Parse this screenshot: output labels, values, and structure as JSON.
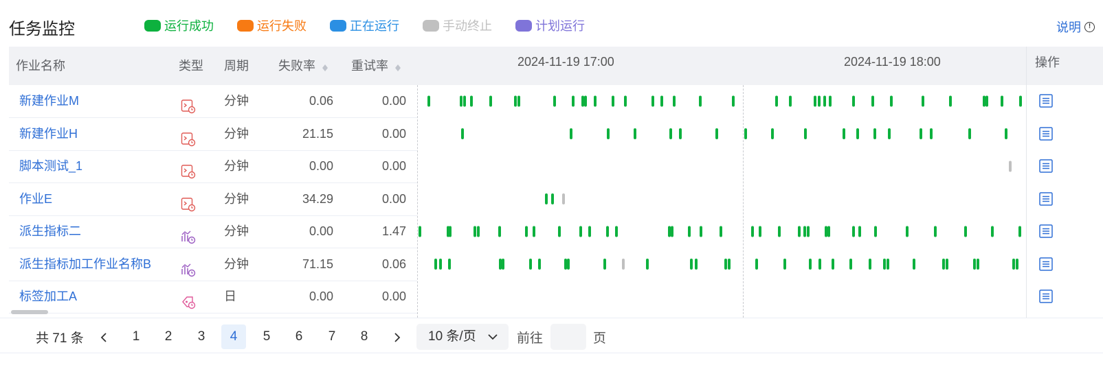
{
  "page": {
    "title": "任务监控",
    "help": "说明"
  },
  "legend": [
    {
      "label": "运行成功",
      "color": "#0db13e"
    },
    {
      "label": "运行失败",
      "color": "#f77a13"
    },
    {
      "label": "正在运行",
      "color": "#2b8fe3"
    },
    {
      "label": "手动终止",
      "color": "#c0c0c0"
    },
    {
      "label": "计划运行",
      "color": "#7f74d9"
    }
  ],
  "table": {
    "headers": {
      "name": "作业名称",
      "type": "类型",
      "period": "周期",
      "fail_rate": "失败率",
      "retry_rate": "重试率",
      "operation": "操作"
    },
    "time_axis": [
      "2024-11-19 17:00",
      "2024-11-19 18:00"
    ],
    "rows": [
      {
        "name": "新建作业M",
        "type_icon": "script-schedule-icon",
        "period": "分钟",
        "fail_rate": "0.06",
        "retry_rate": "0.00"
      },
      {
        "name": "新建作业H",
        "type_icon": "script-schedule-icon",
        "period": "分钟",
        "fail_rate": "21.15",
        "retry_rate": "0.00"
      },
      {
        "name": "脚本测试_1",
        "type_icon": "script-schedule-icon",
        "period": "分钟",
        "fail_rate": "0.00",
        "retry_rate": "0.00"
      },
      {
        "name": "作业E",
        "type_icon": "script-schedule-icon",
        "period": "分钟",
        "fail_rate": "34.29",
        "retry_rate": "0.00"
      },
      {
        "name": "派生指标二",
        "type_icon": "metric-schedule-icon",
        "period": "分钟",
        "fail_rate": "0.00",
        "retry_rate": "1.47"
      },
      {
        "name": "派生指标加工作业名称B",
        "type_icon": "metric-schedule-icon",
        "period": "分钟",
        "fail_rate": "71.15",
        "retry_rate": "0.06"
      },
      {
        "name": "标签加工A",
        "type_icon": "tag-schedule-icon",
        "period": "日",
        "fail_rate": "0.00",
        "retry_rate": "0.00"
      }
    ]
  },
  "pagination": {
    "total": "共 71 条",
    "pages": [
      "1",
      "2",
      "3",
      "4",
      "5",
      "6",
      "7",
      "8"
    ],
    "current": "4",
    "page_size": "10 条/页",
    "goto_label": "前往",
    "goto_value": "",
    "goto_suffix": "页"
  }
}
